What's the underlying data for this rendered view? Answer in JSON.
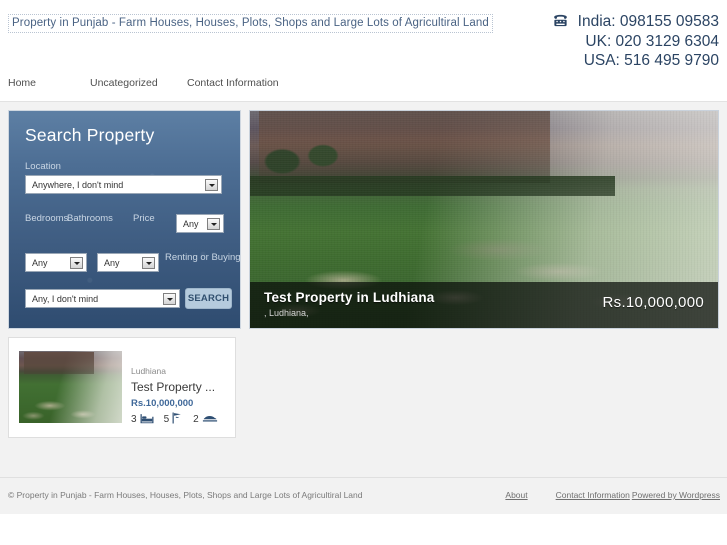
{
  "header": {
    "site_title": "Property in Punjab - Farm Houses, Houses, Plots, Shops and Large Lots of Agricultiral Land",
    "phone_icon": "telephone-icon",
    "phones": [
      {
        "label": "India:",
        "number": "098155 09583",
        "text": "India: 098155 09583"
      },
      {
        "label": "UK:",
        "number": "020 3129 6304",
        "text": "UK: 020 3129 6304"
      },
      {
        "label": "USA:",
        "number": "516 495 9790",
        "text": "USA: 516 495 9790"
      }
    ]
  },
  "nav": {
    "items": [
      {
        "label": "Home"
      },
      {
        "label": "Uncategorized"
      },
      {
        "label": "Contact Information"
      }
    ]
  },
  "search_panel": {
    "title": "Search Property",
    "location_label": "Location",
    "location_value": "Anywhere, I don't mind",
    "bedrooms_label": "Bedrooms",
    "bathrooms_label": "Bathrooms",
    "price_label": "Price",
    "price_value": "Any",
    "bedrooms_value": "Any",
    "bathrooms_value": "Any",
    "renting_label": "Renting or Buying",
    "renting_value": "Any, I don't mind",
    "search_button": "SEARCH"
  },
  "hero": {
    "title": "Test Property in Ludhiana",
    "subtitle": ", Ludhiana,",
    "price": "Rs.10,000,000",
    "image_alt": "house-with-lawn-photo"
  },
  "listing": {
    "city": "Ludhiana",
    "title": "Test Property ...",
    "price": "Rs.10,000,000",
    "thumb_alt": "house-with-lawn-thumbnail",
    "specs": [
      {
        "count": "3",
        "icon": "bed-icon"
      },
      {
        "count": "5",
        "icon": "bath-icon"
      },
      {
        "count": "2",
        "icon": "car-icon"
      }
    ]
  },
  "footer": {
    "copyright": "© Property in Punjab - Farm Houses, Houses, Plots, Shops and Large Lots of Agricultiral Land",
    "links": [
      {
        "label": "About"
      },
      {
        "label": "Contact Information"
      },
      {
        "label": "Powered by Wordpress"
      }
    ]
  },
  "colors": {
    "accent_blue": "#3f6899",
    "panel_top": "#5d7fa4",
    "panel_bottom": "#2f4c70",
    "title_blue": "#4a6384",
    "phone_blue": "#2b4463",
    "search_btn": "#b5cbdd"
  }
}
